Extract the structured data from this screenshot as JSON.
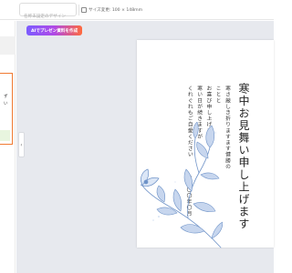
{
  "topbar": {
    "title_placeholder": "名称未設定のデザイン",
    "resize_label": "サイズ変更: 100 × 148mm"
  },
  "left_panel": {
    "line1": "ず",
    "line2": "い"
  },
  "canvas": {
    "ai_button_label": "AIでプレゼン資料を作成",
    "collapse_icon": "chevron-left-icon",
    "collapse_glyph": "‹"
  },
  "card": {
    "title": "寒中お見舞い申し上げます",
    "body_lines": [
      "寒さ厳しき折りますます健勝のことと",
      "お喜び申し上げます",
      "寒い日が続きますが",
      "くれぐれもご自愛ください"
    ],
    "date": "令和〇〇年〇月"
  },
  "colors": {
    "accent_orange": "#f07a32",
    "flower_blue": "#6f93c8",
    "canvas_bg": "#e7e9ee"
  }
}
